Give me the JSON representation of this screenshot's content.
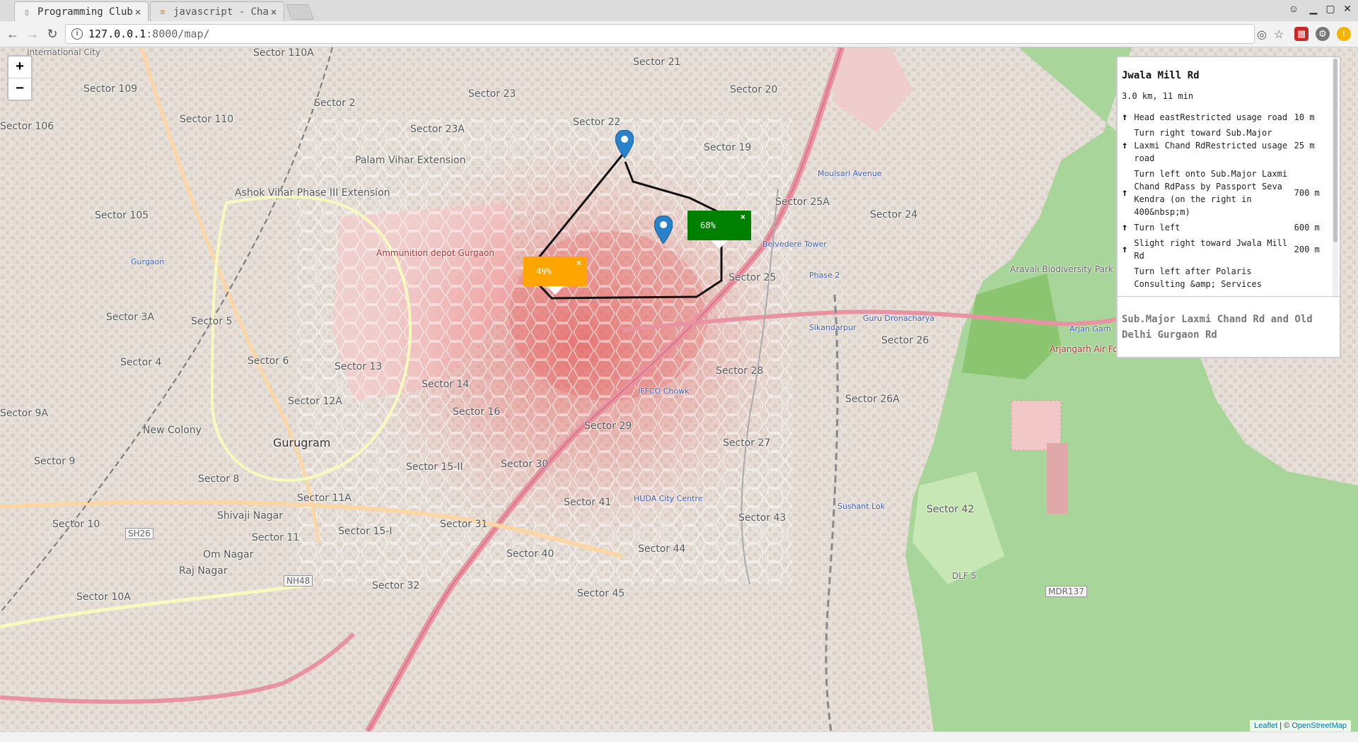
{
  "tabs": [
    {
      "title": "Programming Club",
      "icon": "document-icon",
      "active": true
    },
    {
      "title": "javascript - Char",
      "icon": "stackoverflow-icon",
      "active": false
    }
  ],
  "address": {
    "host": "127.0.0.1",
    "path": ":8000/map/"
  },
  "map": {
    "places": [
      {
        "text": "International City",
        "kind": "small"
      },
      {
        "text": "Sector 110A",
        "kind": "normal"
      },
      {
        "text": "Sector 21",
        "kind": "normal"
      },
      {
        "text": "Sector 109",
        "kind": "normal"
      },
      {
        "text": "Sector 23",
        "kind": "normal"
      },
      {
        "text": "Sector 20",
        "kind": "normal"
      },
      {
        "text": "Sector 2",
        "kind": "normal"
      },
      {
        "text": "Sector 106",
        "kind": "normal"
      },
      {
        "text": "Sector 110",
        "kind": "normal"
      },
      {
        "text": "Sector 23A",
        "kind": "normal"
      },
      {
        "text": "Sector 22",
        "kind": "normal"
      },
      {
        "text": "Palam Vihar Extension",
        "kind": "normal"
      },
      {
        "text": "Sector 19",
        "kind": "normal"
      },
      {
        "text": "Ashok Vihar Phase III Extension",
        "kind": "normal"
      },
      {
        "text": "Sector 105",
        "kind": "normal"
      },
      {
        "text": "Sector 25A",
        "kind": "normal"
      },
      {
        "text": "Sector 24",
        "kind": "normal"
      },
      {
        "text": "Aravali Biodiversity Park",
        "kind": "small"
      },
      {
        "text": "Gurgaon",
        "kind": "blue"
      },
      {
        "text": "Ammunition depot Gurgaon",
        "kind": "red"
      },
      {
        "text": "Sector 3A",
        "kind": "normal"
      },
      {
        "text": "Sector 5",
        "kind": "normal"
      },
      {
        "text": "Sector 25",
        "kind": "normal"
      },
      {
        "text": "Guru Dronacharya",
        "kind": "blue"
      },
      {
        "text": "Sikandarpur",
        "kind": "blue"
      },
      {
        "text": "Arjan Garh",
        "kind": "blue"
      },
      {
        "text": "Sector 4",
        "kind": "normal"
      },
      {
        "text": "Sector 6",
        "kind": "normal"
      },
      {
        "text": "Sector 13",
        "kind": "normal"
      },
      {
        "text": "Sector 26",
        "kind": "normal"
      },
      {
        "text": "Arjangarh Air Force Station",
        "kind": "red"
      },
      {
        "text": "Sector 14",
        "kind": "normal"
      },
      {
        "text": "Sector 28",
        "kind": "normal"
      },
      {
        "text": "Sector 9A",
        "kind": "normal"
      },
      {
        "text": "Sector 12A",
        "kind": "normal"
      },
      {
        "text": "Sector 26A",
        "kind": "normal"
      },
      {
        "text": "Sector 16",
        "kind": "normal"
      },
      {
        "text": "New Colony",
        "kind": "normal"
      },
      {
        "text": "Sector 29",
        "kind": "normal"
      },
      {
        "text": "Gurugram",
        "kind": "big"
      },
      {
        "text": "Sector 27",
        "kind": "normal"
      },
      {
        "text": "Sector 9",
        "kind": "normal"
      },
      {
        "text": "Sector 15-II",
        "kind": "normal"
      },
      {
        "text": "Sector 30",
        "kind": "normal"
      },
      {
        "text": "Sector 8",
        "kind": "normal"
      },
      {
        "text": "Sector 11A",
        "kind": "normal"
      },
      {
        "text": "Sector 41",
        "kind": "normal"
      },
      {
        "text": "HUDA City Centre",
        "kind": "blue"
      },
      {
        "text": "Sector 43",
        "kind": "normal"
      },
      {
        "text": "Sector 42",
        "kind": "normal"
      },
      {
        "text": "Shivaji Nagar",
        "kind": "normal"
      },
      {
        "text": "Sector 10",
        "kind": "normal"
      },
      {
        "text": "Sector 31",
        "kind": "normal"
      },
      {
        "text": "Sushant Lok",
        "kind": "blue"
      },
      {
        "text": "Sector 15-I",
        "kind": "normal"
      },
      {
        "text": "Sector 11",
        "kind": "normal"
      },
      {
        "text": "Sector 44",
        "kind": "normal"
      },
      {
        "text": "Om Nagar",
        "kind": "normal"
      },
      {
        "text": "Sector 40",
        "kind": "normal"
      },
      {
        "text": "Raj Nagar",
        "kind": "normal"
      },
      {
        "text": "Sector 32",
        "kind": "normal"
      },
      {
        "text": "Sector 45",
        "kind": "normal"
      },
      {
        "text": "Sector 10A",
        "kind": "normal"
      },
      {
        "text": "Moulsari Avenue",
        "kind": "blue"
      },
      {
        "text": "Belvedere Tower",
        "kind": "blue"
      },
      {
        "text": "IFFCO Chowk",
        "kind": "blue"
      },
      {
        "text": "Phase 2",
        "kind": "blue"
      },
      {
        "text": "DLF 5",
        "kind": "small"
      },
      {
        "text": "MDR137",
        "kind": "small"
      },
      {
        "text": "SH26",
        "kind": "small"
      },
      {
        "text": "NH48",
        "kind": "small"
      }
    ],
    "popups": [
      {
        "value": "49%",
        "color": "#ffa500",
        "textColor": "#ffffff",
        "closeColor": "#ffffff"
      },
      {
        "value": "68%",
        "color": "#008000",
        "textColor": "#ffffff",
        "closeColor": "#ffffff"
      }
    ],
    "zoom_in": "+",
    "zoom_out": "−"
  },
  "route": {
    "title": "Jwala Mill Rd",
    "summary": "3.0 km, 11 min",
    "steps": [
      {
        "text": "Head eastRestricted usage road",
        "dist": "10 m"
      },
      {
        "text": "Turn right toward Sub.Major Laxmi Chand RdRestricted usage road",
        "dist": "25 m"
      },
      {
        "text": "Turn left onto Sub.Major Laxmi Chand RdPass by Passport Seva Kendra (on the right in 400&nbsp;m)",
        "dist": "700 m"
      },
      {
        "text": "Turn left",
        "dist": "600 m"
      },
      {
        "text": "Slight right toward Jwala Mill Rd",
        "dist": "200 m"
      },
      {
        "text": "Turn left after Polaris Consulting &amp; Services",
        "dist": ""
      }
    ],
    "alternative": "Sub.Major Laxmi Chand Rd and Old Delhi Gurgaon Rd"
  },
  "attribution": {
    "leaflet": "Leaflet",
    "sep": " | © ",
    "osm": "OpenStreetMap"
  },
  "colors": {
    "heat": "#e84a4a",
    "park": "#8cc56f",
    "primaryRoad": "#e892a2",
    "routeLine": "#111111"
  }
}
